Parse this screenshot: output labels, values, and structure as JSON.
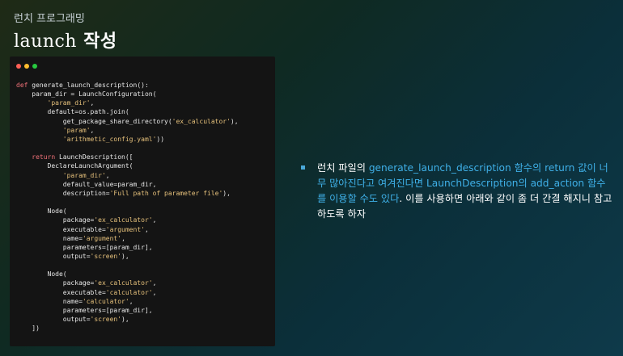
{
  "header": {
    "subtitle": "런치 프로그래밍",
    "title_latin": "launch",
    "title_korean": "작성"
  },
  "code_window": {
    "lines": [
      {
        "kw": "def",
        "text": " generate_launch_description():"
      },
      {
        "text": "    param_dir = LaunchConfiguration("
      },
      {
        "str": "        'param_dir'",
        "text": ","
      },
      {
        "text": "        default=os.path.join("
      },
      {
        "text": "            get_package_share_directory(",
        "str": "'ex_calculator'",
        "tail": "),"
      },
      {
        "str": "            'param'",
        "text": ","
      },
      {
        "str": "            'arithmetic_config.yaml'",
        "text": "))"
      },
      {
        "text": ""
      },
      {
        "kw": "    return",
        "text": " LaunchDescription(["
      },
      {
        "text": "        DeclareLaunchArgument("
      },
      {
        "str": "            'param_dir'",
        "text": ","
      },
      {
        "text": "            default_value=param_dir,"
      },
      {
        "text": "            description=",
        "str": "'Full path of parameter file'",
        "tail": "),"
      },
      {
        "text": ""
      },
      {
        "text": "        Node("
      },
      {
        "text": "            package=",
        "str": "'ex_calculator'",
        "tail": ","
      },
      {
        "text": "            executable=",
        "str": "'argument'",
        "tail": ","
      },
      {
        "text": "            name=",
        "str": "'argument'",
        "tail": ","
      },
      {
        "text": "            parameters=[param_dir],"
      },
      {
        "text": "            output=",
        "str": "'screen'",
        "tail": "),"
      },
      {
        "text": ""
      },
      {
        "text": "        Node("
      },
      {
        "text": "            package=",
        "str": "'ex_calculator'",
        "tail": ","
      },
      {
        "text": "            executable=",
        "str": "'calculator'",
        "tail": ","
      },
      {
        "text": "            name=",
        "str": "'calculator'",
        "tail": ","
      },
      {
        "text": "            parameters=[param_dir],"
      },
      {
        "text": "            output=",
        "str": "'screen'",
        "tail": "),"
      },
      {
        "text": "    ])"
      }
    ]
  },
  "bullet": {
    "t1": "런치 파일의 ",
    "h1": "generate_launch_description 함수의 return 값이 너무 많아진다고 여겨진다면 LaunchDescription의 add_action 함수를 이용할 수도 있다",
    "t2": ". 이를 사용하면 아래와 같이 좀 더 간결 해지니 참고하도록 하자"
  },
  "colors": {
    "accent": "#3fb0e8",
    "keyword": "#f07178",
    "string": "#e5c07b"
  }
}
